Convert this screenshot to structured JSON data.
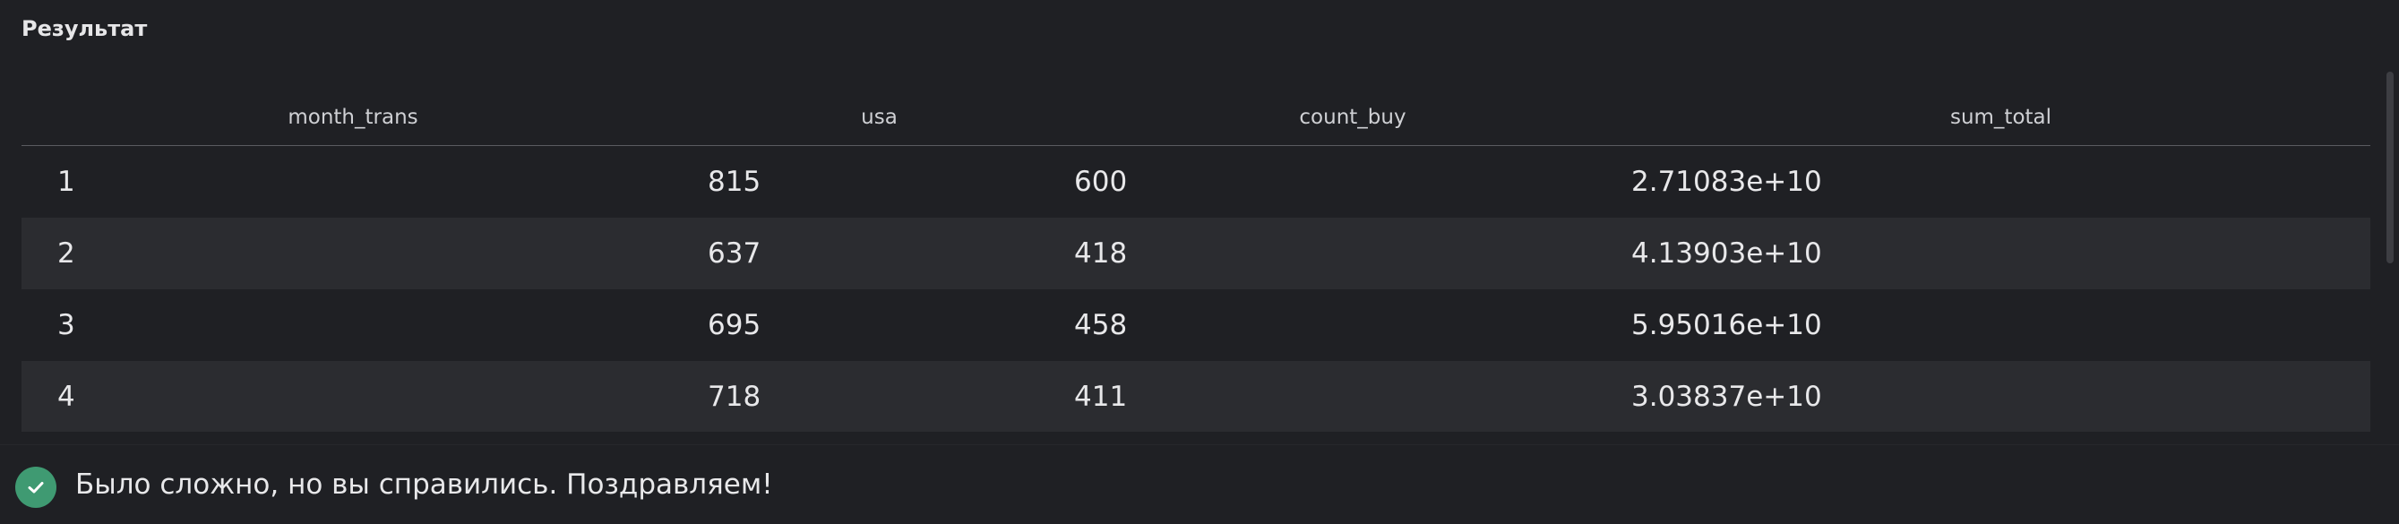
{
  "panel": {
    "title": "Результат"
  },
  "table": {
    "columns": [
      "month_trans",
      "usa",
      "count_buy",
      "sum_total"
    ],
    "rows": [
      [
        "1",
        "815",
        "600",
        "2.71083e+10"
      ],
      [
        "2",
        "637",
        "418",
        "4.13903e+10"
      ],
      [
        "3",
        "695",
        "458",
        "5.95016e+10"
      ],
      [
        "4",
        "718",
        "411",
        "3.03837e+10"
      ]
    ]
  },
  "footer": {
    "status_icon": "check-icon",
    "status_color": "#3f9a72",
    "message": "Было сложно, но вы справились. Поздравляем!"
  }
}
